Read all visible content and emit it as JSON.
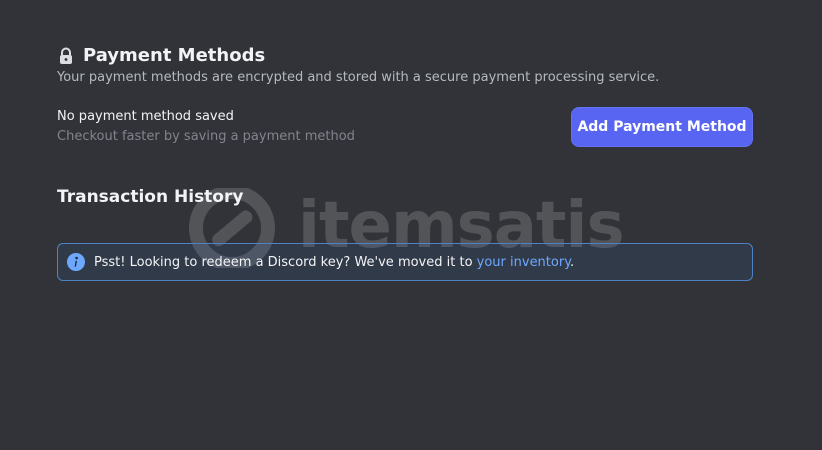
{
  "payment": {
    "title": "Payment Methods",
    "description": "Your payment methods are encrypted and stored with a secure payment processing service.",
    "empty_title": "No payment method saved",
    "empty_subtitle": "Checkout faster by saving a payment method",
    "add_button_label": "Add Payment Method",
    "lock_icon": "lock-icon"
  },
  "history": {
    "title": "Transaction History"
  },
  "notice": {
    "icon": "info-icon",
    "text_prefix": "Psst! Looking to redeem a Discord key? We've moved it to ",
    "link_text": "your inventory",
    "text_suffix": "."
  },
  "watermark": {
    "text": "itemsatis",
    "logo_icon": "itemsatis-logo-icon"
  },
  "colors": {
    "background": "#313338",
    "accent": "#5865f2",
    "link": "#6ea8fe",
    "notice_border": "#4d82c6"
  }
}
